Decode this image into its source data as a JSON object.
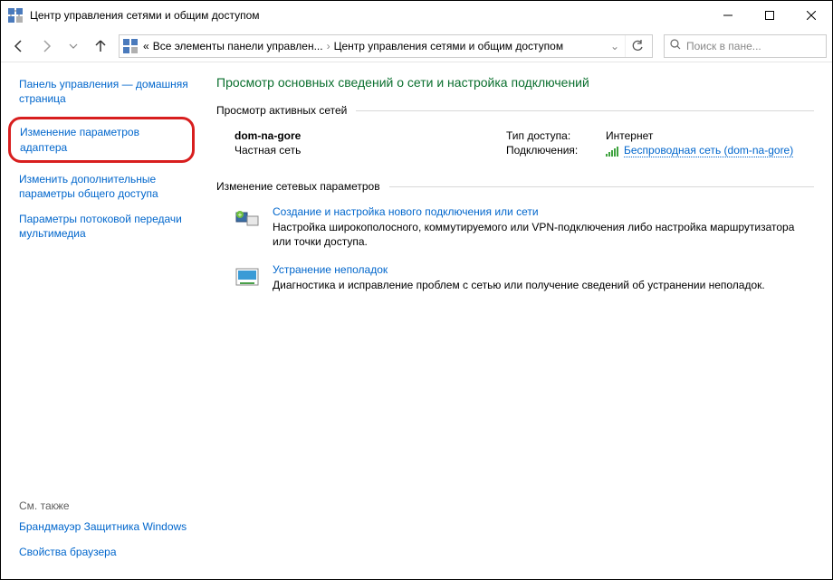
{
  "window": {
    "title": "Центр управления сетями и общим доступом"
  },
  "breadcrumb": {
    "prefix": "«",
    "seg1": "Все элементы панели управлен...",
    "seg2": "Центр управления сетями и общим доступом"
  },
  "search": {
    "placeholder": "Поиск в пане..."
  },
  "sidebar": {
    "home": "Панель управления — домашняя страница",
    "adapter": "Изменение параметров адаптера",
    "sharing": "Изменить дополнительные параметры общего доступа",
    "streaming": "Параметры потоковой передачи мультимедиа",
    "see_also": "См. также",
    "firewall": "Брандмауэр Защитника Windows",
    "browser": "Свойства браузера"
  },
  "main": {
    "heading": "Просмотр основных сведений о сети и настройка подключений",
    "active_networks_label": "Просмотр активных сетей",
    "net_name": "dom-na-gore",
    "net_type": "Частная сеть",
    "access_label": "Тип доступа:",
    "access_value": "Интернет",
    "conn_label": "Подключения:",
    "conn_value": "Беспроводная сеть (dom-na-gore)",
    "change_params_label": "Изменение сетевых параметров",
    "param1": {
      "title": "Создание и настройка нового подключения или сети",
      "desc": "Настройка широкополосного, коммутируемого или VPN-подключения либо настройка маршрутизатора или точки доступа."
    },
    "param2": {
      "title": "Устранение неполадок",
      "desc": "Диагностика и исправление проблем с сетью или получение сведений об устранении неполадок."
    }
  }
}
